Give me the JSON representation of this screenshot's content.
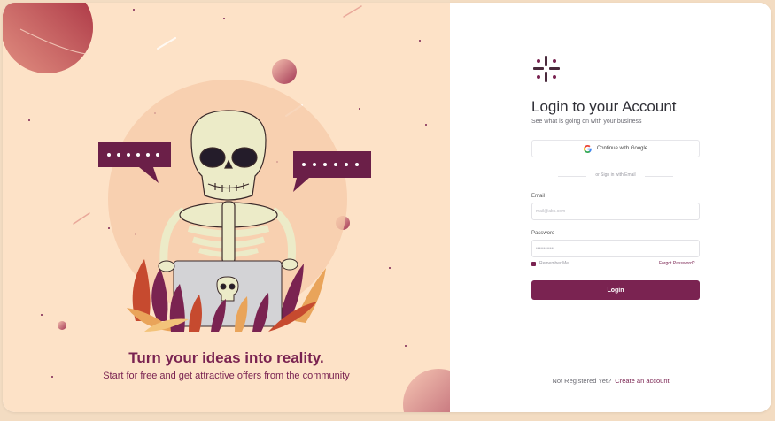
{
  "illustration": {
    "title": "Turn your ideas into reality.",
    "subtitle": "Start for free and get attractive offers from the community"
  },
  "login": {
    "title": "Login to your Account",
    "subtitle": "See what is going on with your business",
    "google_button": "Continue with Google",
    "divider": "or Sign in with Email",
    "email_label": "Email",
    "email_placeholder": "mail@abc.com",
    "password_label": "Password",
    "password_placeholder": "••••••••••••",
    "remember_me": "Remember Me",
    "forgot_password": "Forgot Password?",
    "login_button": "Login",
    "footer_text": "Not Registered Yet?",
    "footer_link": "Create an account"
  },
  "colors": {
    "brand": "#7a2351",
    "panel_bg": "#fde2c7"
  }
}
